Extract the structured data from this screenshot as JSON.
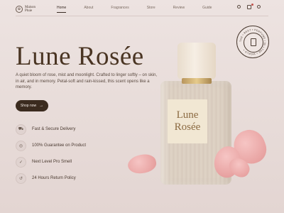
{
  "header": {
    "brand": "Maison Pluie",
    "nav": [
      {
        "label": "Home",
        "active": true
      },
      {
        "label": "About",
        "active": false
      },
      {
        "label": "Fragrances",
        "active": false
      },
      {
        "label": "Store",
        "active": false
      },
      {
        "label": "Review",
        "active": false
      },
      {
        "label": "Guide",
        "active": false
      }
    ],
    "icons": [
      "search-icon",
      "bag-icon",
      "user-icon"
    ]
  },
  "hero": {
    "title": "Lune Rosée",
    "description": "A quiet bloom of rose, mist and moonlight. Crafted to linger softly – on skin, in air, and in memory. Petal-soft and rain-kissed, this scent opens like a memory.",
    "cta": "Shop now",
    "cta_icon": "arrow-right-icon"
  },
  "features": [
    {
      "icon": "truck-icon",
      "label": "Fast & Secure Delivery"
    },
    {
      "icon": "guarantee-icon",
      "label": "100% Guarantee on Product"
    },
    {
      "icon": "nose-icon",
      "label": "Next Level Pro Smell"
    },
    {
      "icon": "return-icon",
      "label": "24 Hours Return Policy"
    }
  ],
  "badge": {
    "text": "THE • BEST • PERFUME • IN • THE • WORLD •"
  },
  "bottle": {
    "label_line1": "Lune",
    "label_line2": "Rosée"
  },
  "colors": {
    "accent": "#3b2b1f",
    "background": "#eadfdd",
    "petal": "#eaa9a8"
  }
}
